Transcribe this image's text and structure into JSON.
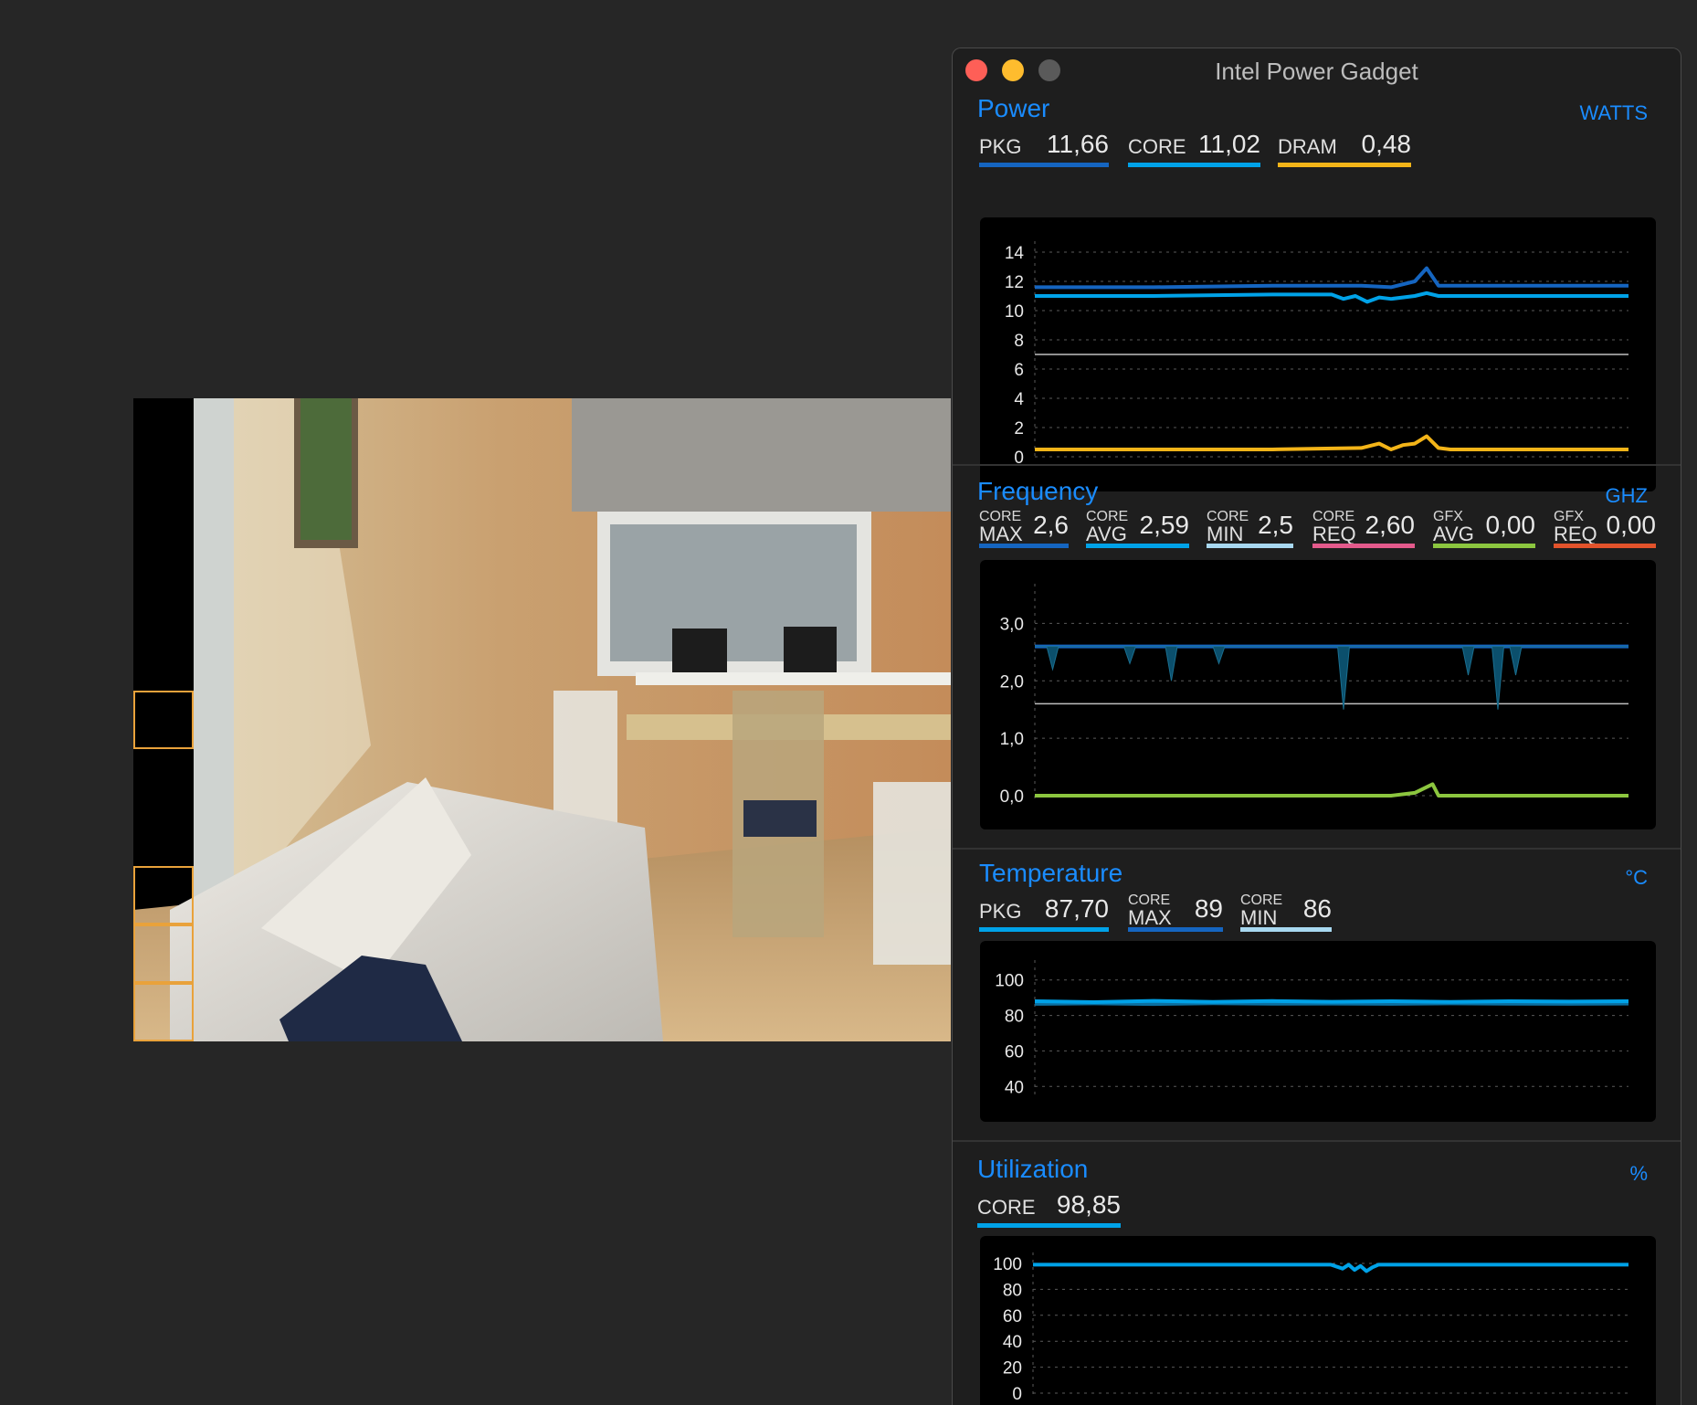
{
  "window": {
    "title": "Intel Power Gadget",
    "traffic_lights": [
      "close-icon",
      "minimize-icon",
      "zoom-icon"
    ]
  },
  "colors": {
    "accent": "#1a8cff",
    "pkg": "#1565c0",
    "core": "#00a2e8",
    "dram": "#f3b418",
    "min": "#a8d8f0",
    "req": "#e45a8c",
    "gfx_avg": "#8cc63f",
    "gfx_req": "#e3532b"
  },
  "sections": {
    "power": {
      "title": "Power",
      "unit": "WATTS",
      "metrics": [
        {
          "label": "PKG",
          "value": "11,66"
        },
        {
          "label": "CORE",
          "value": "11,02"
        },
        {
          "label": "DRAM",
          "value": "0,48"
        }
      ]
    },
    "frequency": {
      "title": "Frequency",
      "unit": "GHZ",
      "metrics": [
        {
          "top": "CORE",
          "bottom": "MAX",
          "value": "2,6"
        },
        {
          "top": "CORE",
          "bottom": "AVG",
          "value": "2,59"
        },
        {
          "top": "CORE",
          "bottom": "MIN",
          "value": "2,5"
        },
        {
          "top": "CORE",
          "bottom": "REQ",
          "value": "2,60"
        },
        {
          "top": "GFX",
          "bottom": "AVG",
          "value": "0,00"
        },
        {
          "top": "GFX",
          "bottom": "REQ",
          "value": "0,00"
        }
      ]
    },
    "temperature": {
      "title": "Temperature",
      "unit": "°C",
      "metrics": [
        {
          "label": "PKG",
          "value": "87,70"
        },
        {
          "top": "CORE",
          "bottom": "MAX",
          "value": "89"
        },
        {
          "top": "CORE",
          "bottom": "MIN",
          "value": "86"
        }
      ]
    },
    "utilization": {
      "title": "Utilization",
      "unit": "%",
      "metrics": [
        {
          "label": "CORE",
          "value": "98,85"
        }
      ]
    }
  },
  "chart_data": [
    {
      "type": "line",
      "ylim": [
        0,
        14
      ],
      "yticks": [
        "0",
        "2",
        "4",
        "6",
        "8",
        "10",
        "12",
        "14"
      ],
      "reference_line": 7,
      "series": [
        {
          "key": "PKG",
          "color": "#1565c0",
          "x": [
            0,
            20,
            40,
            55,
            60,
            64,
            66,
            68,
            70,
            80,
            100
          ],
          "y": [
            11.6,
            11.6,
            11.7,
            11.7,
            11.6,
            12.0,
            12.9,
            11.7,
            11.7,
            11.7,
            11.7
          ]
        },
        {
          "key": "CORE",
          "color": "#00a2e8",
          "x": [
            0,
            20,
            40,
            50,
            52,
            54,
            56,
            58,
            60,
            64,
            66,
            68,
            70,
            80,
            100
          ],
          "y": [
            11.0,
            11.0,
            11.1,
            11.1,
            10.8,
            11.0,
            10.6,
            10.9,
            10.8,
            11.0,
            11.2,
            11.0,
            11.0,
            11.0,
            11.0
          ]
        },
        {
          "key": "DRAM",
          "color": "#f3b418",
          "x": [
            0,
            20,
            40,
            55,
            58,
            60,
            62,
            64,
            66,
            68,
            70,
            80,
            100
          ],
          "y": [
            0.5,
            0.5,
            0.5,
            0.6,
            0.9,
            0.5,
            0.8,
            0.9,
            1.4,
            0.6,
            0.5,
            0.5,
            0.5
          ]
        }
      ]
    },
    {
      "type": "area",
      "ylim": [
        0,
        3.5
      ],
      "yticks": [
        "0,0",
        "1,0",
        "2,0",
        "3,0"
      ],
      "reference_line": 1.6,
      "series": [
        {
          "key": "CORE MAX",
          "color": "#1565c0",
          "x": [
            0,
            100
          ],
          "y": [
            2.6,
            2.6
          ]
        },
        {
          "key": "CORE AVG",
          "color": "#0b4f6c",
          "x": [
            0,
            2,
            3,
            4,
            15,
            16,
            17,
            22,
            23,
            24,
            30,
            31,
            32,
            51,
            52,
            53,
            72,
            73,
            74,
            77,
            78,
            79,
            80,
            81,
            82,
            100
          ],
          "y": [
            2.6,
            2.6,
            2.2,
            2.6,
            2.6,
            2.3,
            2.6,
            2.6,
            2.0,
            2.6,
            2.6,
            2.3,
            2.6,
            2.6,
            1.5,
            2.6,
            2.6,
            2.1,
            2.6,
            2.6,
            1.5,
            2.6,
            2.6,
            2.1,
            2.6,
            2.6
          ]
        },
        {
          "key": "GFX AVG",
          "color": "#8cc63f",
          "x": [
            0,
            20,
            40,
            55,
            60,
            64,
            67,
            68,
            70,
            80,
            100
          ],
          "y": [
            0.0,
            0.0,
            0.0,
            0.0,
            0.0,
            0.05,
            0.2,
            0.0,
            0.0,
            0.0,
            0.0
          ]
        }
      ]
    },
    {
      "type": "line",
      "ylim": [
        35,
        105
      ],
      "yticks": [
        "40",
        "60",
        "80",
        "100"
      ],
      "series": [
        {
          "key": "CORE MIN",
          "color": "#0b6fa0",
          "x": [
            0,
            10,
            20,
            30,
            40,
            50,
            60,
            70,
            80,
            90,
            100
          ],
          "y": [
            86.5,
            86.8,
            86.4,
            86.9,
            86.6,
            86.7,
            86.5,
            86.8,
            86.6,
            86.5,
            86.7
          ]
        },
        {
          "key": "PKG",
          "color": "#00a2e8",
          "x": [
            0,
            10,
            20,
            30,
            40,
            50,
            60,
            70,
            80,
            90,
            100
          ],
          "y": [
            88,
            87.5,
            88.2,
            87.6,
            88.1,
            87.7,
            88,
            87.6,
            88,
            87.8,
            88
          ]
        }
      ]
    },
    {
      "type": "line",
      "ylim": [
        0,
        100
      ],
      "yticks": [
        "0",
        "20",
        "40",
        "60",
        "80",
        "100"
      ],
      "series": [
        {
          "key": "CORE",
          "color": "#00a2e8",
          "x": [
            0,
            20,
            40,
            50,
            52,
            53,
            54,
            55,
            56,
            57,
            58,
            60,
            70,
            100
          ],
          "y": [
            99,
            99,
            99,
            99,
            96,
            99,
            95,
            98,
            94,
            97,
            99,
            99,
            99,
            99
          ]
        }
      ]
    }
  ]
}
